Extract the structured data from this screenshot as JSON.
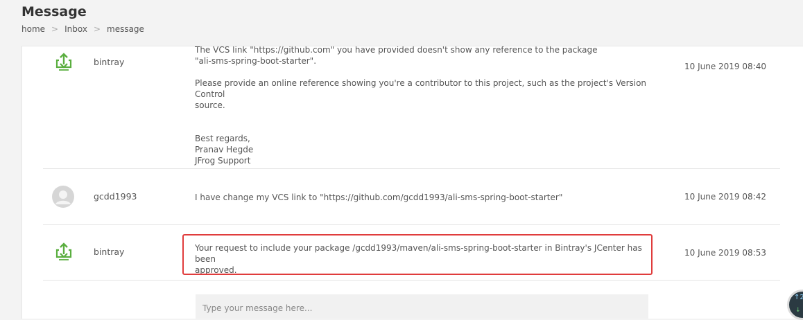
{
  "header": {
    "title": "Message",
    "breadcrumb": {
      "home": "home",
      "inbox": "Inbox",
      "current": "message",
      "separator": ">"
    }
  },
  "messages": [
    {
      "sender": "bintray",
      "avatar_icon": "bintray-upload-icon",
      "lines": [
        "The VCS link \"https://github.com\" you have provided doesn't show any reference to the package",
        "\"ali-sms-spring-boot-starter\".",
        "Please provide an online reference showing you're a contributor to this project, such as the project's Version Control",
        "source.",
        "Best regards,",
        "Pranav Hegde",
        "JFrog Support"
      ],
      "timestamp": "10 June 2019 08:40"
    },
    {
      "sender": "gcdd1993",
      "avatar_icon": "default-user-avatar-icon",
      "text": "I have change my VCS link to \"https://github.com/gcdd1993/ali-sms-spring-boot-starter\"",
      "timestamp": "10 June 2019 08:42"
    },
    {
      "sender": "bintray",
      "avatar_icon": "bintray-upload-icon",
      "lines": [
        "Your request to include your package /gcdd1993/maven/ali-sms-spring-boot-starter in Bintray's JCenter has been",
        "approved."
      ],
      "timestamp": "10 June 2019 08:53"
    }
  ],
  "compose": {
    "placeholder": "Type your message here..."
  },
  "badge": {
    "up": "↑2",
    "down": "↓"
  },
  "colors": {
    "highlight": "#e03c3c",
    "bintray_green": "#5aae3f"
  }
}
